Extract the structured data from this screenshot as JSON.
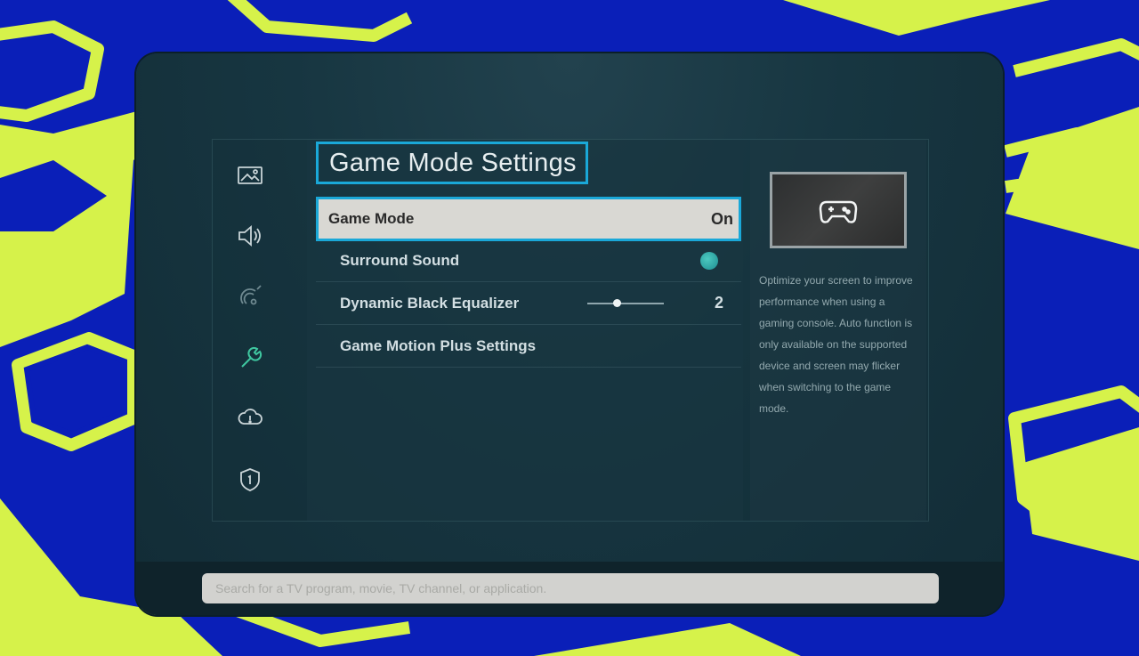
{
  "menu": {
    "title": "Game Mode Settings",
    "items": [
      {
        "label": "Game Mode",
        "value": "On"
      },
      {
        "label": "Surround Sound"
      },
      {
        "label": "Dynamic Black Equalizer",
        "value": "2"
      },
      {
        "label": "Game Motion Plus Settings"
      }
    ]
  },
  "sidebar": {
    "icons": [
      "picture-icon",
      "sound-icon",
      "broadcast-icon",
      "wrench-icon",
      "cloud-support-icon",
      "shield-icon"
    ]
  },
  "info": {
    "description": "Optimize your screen to improve performance when using a gaming console. Auto function is only available on the supported device and screen may flicker when switching to the game mode."
  },
  "search": {
    "placeholder": "Search for a TV program, movie, TV channel, or application."
  },
  "colors": {
    "highlight": "#1aa8d8",
    "background": "#d6f24a",
    "decor": "#0a1fb8"
  }
}
